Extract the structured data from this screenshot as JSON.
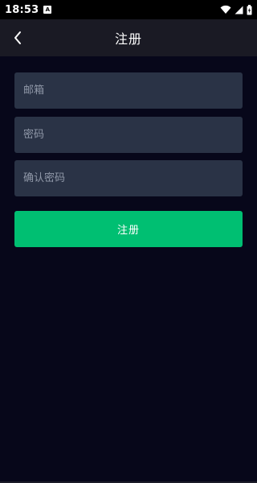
{
  "status_bar": {
    "time": "18:53",
    "notification_letter": "A"
  },
  "header": {
    "title": "注册"
  },
  "form": {
    "email_placeholder": "邮箱",
    "password_placeholder": "密码",
    "confirm_placeholder": "确认密码",
    "email_value": "",
    "password_value": "",
    "confirm_value": "",
    "submit_label": "注册"
  },
  "icons": {
    "back": "chevron-left-icon",
    "wifi": "wifi-icon",
    "signal": "cell-signal-icon",
    "battery": "battery-icon"
  },
  "colors": {
    "background": "#07071a",
    "appbar": "#1a1a24",
    "field": "#2a3346",
    "accent": "#00bf72"
  }
}
